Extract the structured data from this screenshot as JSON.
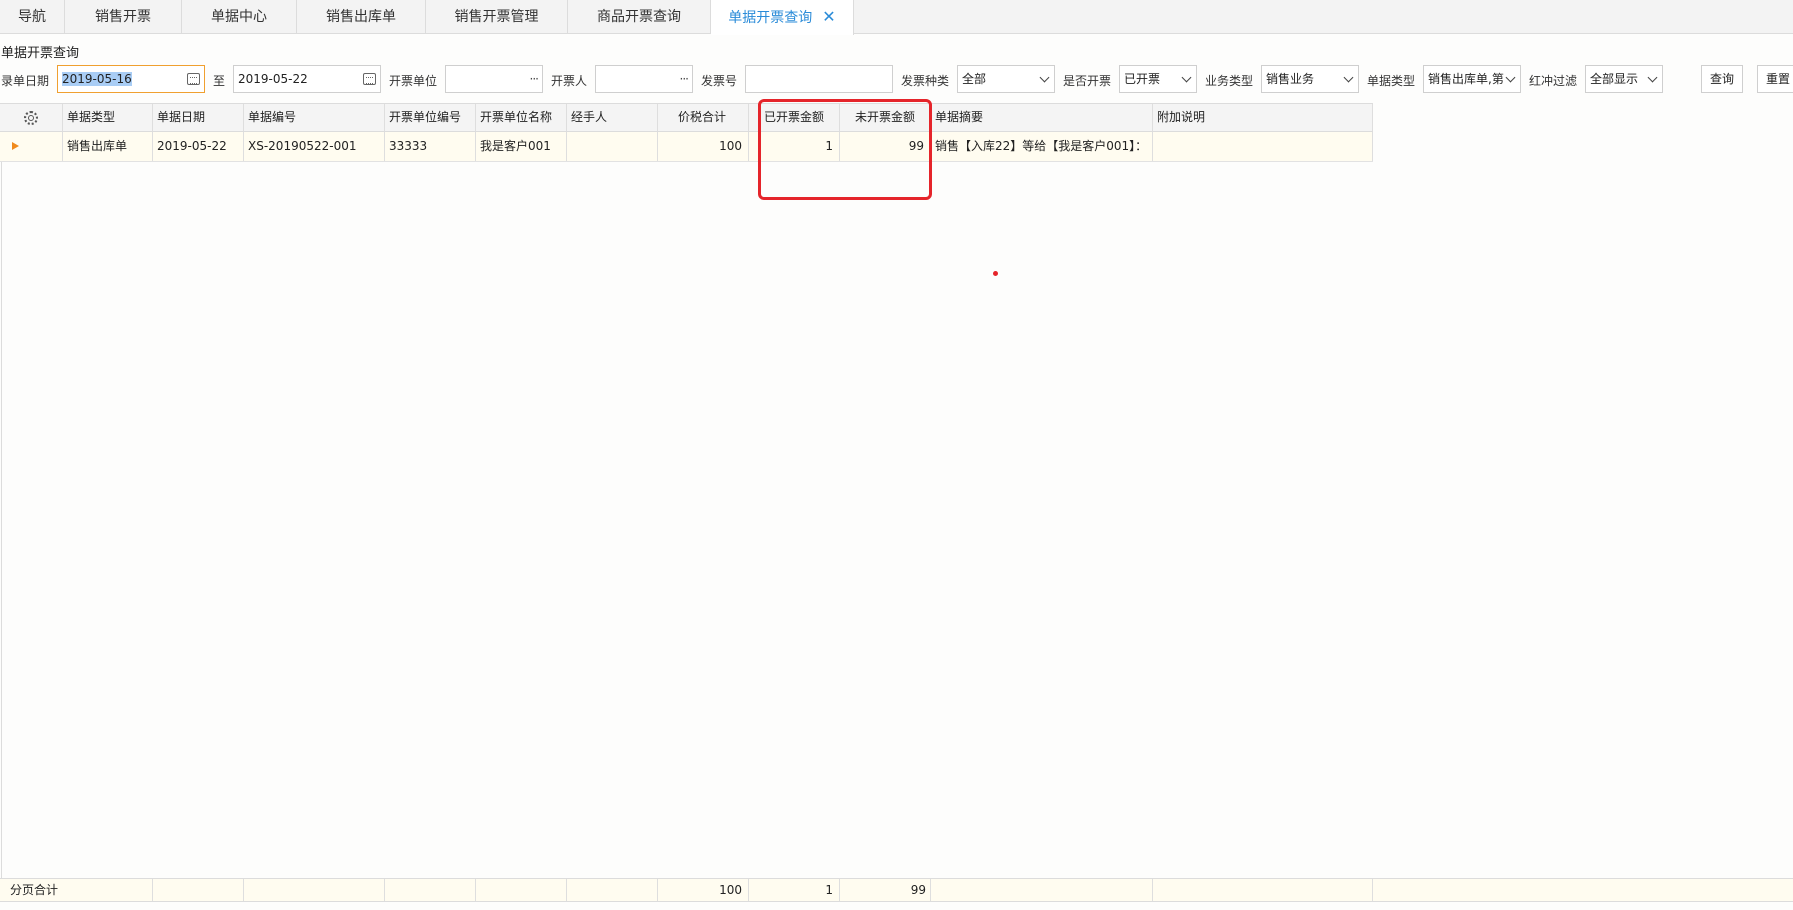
{
  "tabs": [
    {
      "label": "导航"
    },
    {
      "label": "销售开票"
    },
    {
      "label": "单据中心"
    },
    {
      "label": "销售出库单"
    },
    {
      "label": "销售开票管理"
    },
    {
      "label": "商品开票查询"
    },
    {
      "label": "单据开票查询",
      "active": true
    }
  ],
  "page_title": "单据开票查询",
  "filters": {
    "date_label": "录单日期",
    "date_from": "2019-05-16",
    "to_label": "至",
    "date_to": "2019-05-22",
    "invoice_unit_label": "开票单位",
    "invoice_unit": "",
    "invoicer_label": "开票人",
    "invoicer": "",
    "invoice_no_label": "发票号",
    "invoice_no": "",
    "invoice_type_label": "发票种类",
    "invoice_type": "全部",
    "invoiced_label": "是否开票",
    "invoiced": "已开票",
    "business_type_label": "业务类型",
    "business_type": "销售业务",
    "doc_type_label": "单据类型",
    "doc_type": "销售出库单,第",
    "redflush_label": "红冲过滤",
    "redflush": "全部显示",
    "query_label": "查询",
    "reset_label": "重置"
  },
  "columns": [
    "单据类型",
    "单据日期",
    "单据编号",
    "开票单位编号",
    "开票单位名称",
    "经手人",
    "价税合计",
    "已开票金额",
    "未开票金额",
    "单据摘要",
    "附加说明"
  ],
  "rows": [
    {
      "doc_type": "销售出库单",
      "doc_date": "2019-05-22",
      "doc_no": "XS-20190522-001",
      "unit_code": "33333",
      "unit_name": "我是客户001",
      "handler": "",
      "total": "100",
      "invoiced_amt": "1",
      "uninvoiced_amt": "99",
      "summary": "销售【入库22】等给【我是客户001】：",
      "note": ""
    }
  ],
  "footer": {
    "label": "分页合计",
    "total": "100",
    "invoiced_amt": "1",
    "uninvoiced_amt": "99"
  },
  "colors": {
    "accent": "#2a8bd8",
    "highlight": "#e5242a",
    "row_bg": "#fffcf0"
  }
}
